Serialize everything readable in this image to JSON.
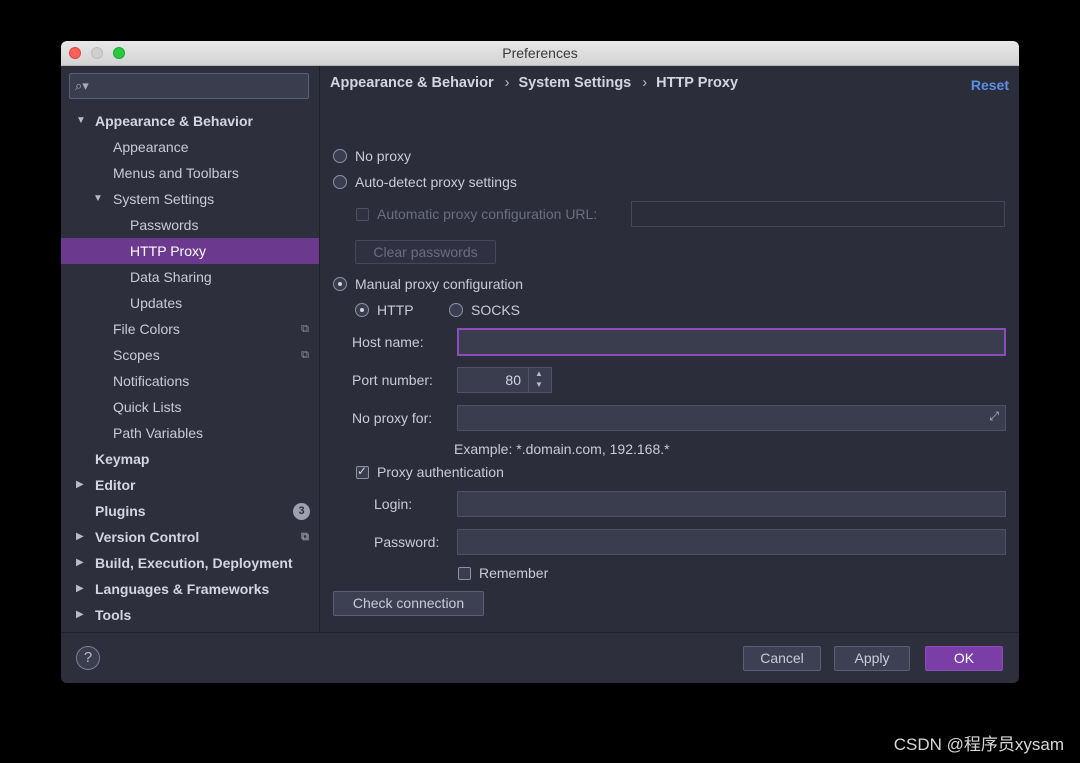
{
  "window": {
    "title": "Preferences"
  },
  "sidebar": {
    "search_placeholder": "",
    "items": [
      {
        "label": "Appearance & Behavior",
        "bold": true
      },
      {
        "label": "Appearance"
      },
      {
        "label": "Menus and Toolbars"
      },
      {
        "label": "System Settings"
      },
      {
        "label": "Passwords"
      },
      {
        "label": "HTTP Proxy",
        "selected": true
      },
      {
        "label": "Data Sharing"
      },
      {
        "label": "Updates"
      },
      {
        "label": "File Colors"
      },
      {
        "label": "Scopes"
      },
      {
        "label": "Notifications"
      },
      {
        "label": "Quick Lists"
      },
      {
        "label": "Path Variables"
      },
      {
        "label": "Keymap",
        "bold": true
      },
      {
        "label": "Editor",
        "bold": true
      },
      {
        "label": "Plugins",
        "bold": true,
        "badge": "3"
      },
      {
        "label": "Version Control",
        "bold": true
      },
      {
        "label": "Build, Execution, Deployment",
        "bold": true
      },
      {
        "label": "Languages & Frameworks",
        "bold": true
      },
      {
        "label": "Tools",
        "bold": true
      }
    ]
  },
  "breadcrumb": [
    "Appearance & Behavior",
    "System Settings",
    "HTTP Proxy"
  ],
  "breadcrumb_sep": "›",
  "reset_label": "Reset",
  "proxy": {
    "no_proxy_label": "No proxy",
    "auto_detect_label": "Auto-detect proxy settings",
    "auto_config_url_label": "Automatic proxy configuration URL:",
    "auto_config_url_value": "",
    "clear_passwords_label": "Clear passwords",
    "manual_label": "Manual proxy configuration",
    "selected_mode": "manual",
    "http_label": "HTTP",
    "socks_label": "SOCKS",
    "selected_protocol": "HTTP",
    "host_name_label": "Host name:",
    "host_name_value": "",
    "port_number_label": "Port number:",
    "port_number_value": "80",
    "no_proxy_for_label": "No proxy for:",
    "no_proxy_for_value": "",
    "example_text": "Example: *.domain.com, 192.168.*",
    "proxy_auth_label": "Proxy authentication",
    "proxy_auth_checked": true,
    "login_label": "Login:",
    "login_value": "",
    "password_label": "Password:",
    "password_value": "",
    "remember_label": "Remember",
    "remember_checked": false,
    "check_connection_label": "Check connection"
  },
  "footer": {
    "help_label": "?",
    "cancel_label": "Cancel",
    "apply_label": "Apply",
    "ok_label": "OK"
  },
  "watermark": "CSDN @程序员xysam",
  "colors": {
    "accent": "#7a3ea6",
    "selection": "#6b3a8e",
    "link": "#5b8ee6",
    "background": "#2b2d3a"
  }
}
